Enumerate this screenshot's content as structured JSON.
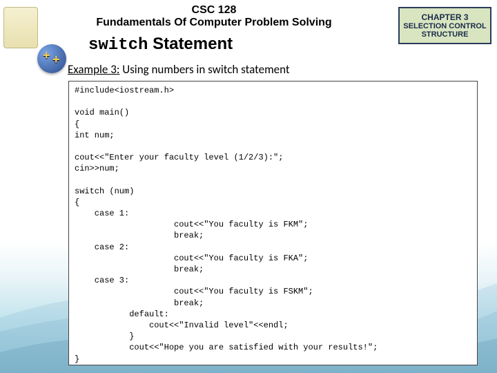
{
  "header": {
    "course_code": "CSC 128",
    "course_title": "Fundamentals Of Computer Problem Solving"
  },
  "chapter": {
    "line1": "CHAPTER 3",
    "line2": "SELECTION CONTROL",
    "line3": "STRUCTURE"
  },
  "section": {
    "keyword": "switch",
    "rest": " Statement"
  },
  "example": {
    "label": "Example 3:",
    "desc": " Using numbers in switch statement"
  },
  "code": "#include<iostream.h>\n\nvoid main()\n{\nint num;\n\ncout<<\"Enter your faculty level (1/2/3):\";\ncin>>num;\n\nswitch (num)\n{\n    case 1:\n                    cout<<\"You faculty is FKM\";\n                    break;\n    case 2:\n                    cout<<\"You faculty is FKA\";\n                    break;\n    case 3:\n                    cout<<\"You faculty is FSKM\";\n                    break;\n           default:\n               cout<<\"Invalid level\"<<endl;\n           }\n           cout<<\"Hope you are satisfied with your results!\";\n}"
}
